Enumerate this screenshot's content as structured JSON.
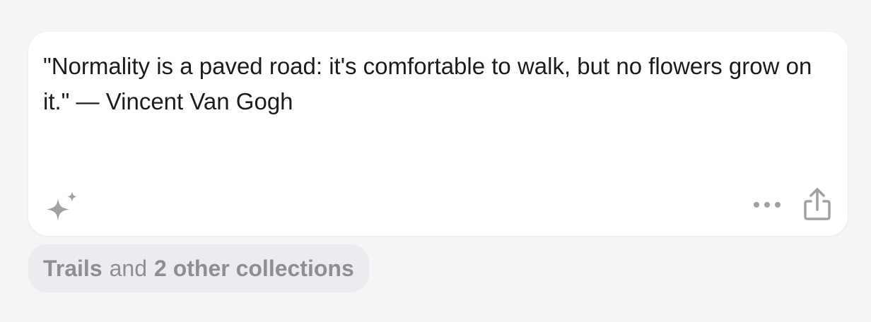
{
  "card": {
    "quote": "\"Normality is a paved road: it's comfortable to walk, but no flowers grow on it.\" — Vincent Van Gogh",
    "icons": {
      "ai": "sparkle-icon",
      "more": "more-icon",
      "share": "share-icon"
    }
  },
  "collections": {
    "primary": "Trails",
    "connector": "and",
    "others": "2 other collections"
  },
  "colors": {
    "background": "#f5f5f7",
    "card": "#ffffff",
    "text": "#1c1c1e",
    "icon": "#a1a1a6",
    "pill": "#ebebf0",
    "pill_text": "#8e8e93"
  }
}
